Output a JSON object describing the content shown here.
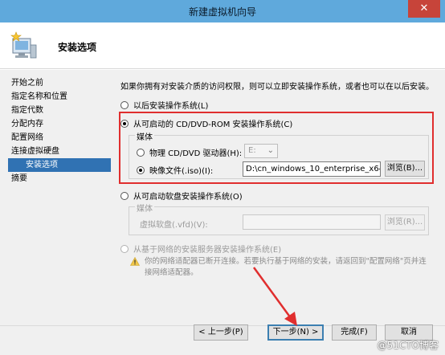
{
  "window": {
    "title": "新建虚拟机向导",
    "close_glyph": "✕"
  },
  "header": {
    "page_title": "安装选项"
  },
  "nav": {
    "items": [
      {
        "label": "开始之前"
      },
      {
        "label": "指定名称和位置"
      },
      {
        "label": "指定代数"
      },
      {
        "label": "分配内存"
      },
      {
        "label": "配置网络"
      },
      {
        "label": "连接虚拟硬盘"
      },
      {
        "label": "安装选项"
      },
      {
        "label": "摘要"
      }
    ],
    "active_index": 6
  },
  "content": {
    "intro": "如果你拥有对安装介质的访问权限，则可以立即安装操作系统，或者也可以在以后安装。",
    "option_later": "以后安装操作系统(L)",
    "option_dvd": "从可启动的 CD/DVD-ROM 安装操作系统(C)",
    "dvd_group_label": "媒体",
    "physical_drive_label": "物理 CD/DVD 驱动器(H):",
    "physical_drive_value": "E:",
    "iso_label": "映像文件(.iso)(I):",
    "iso_value": "D:\\cn_windows_10_enterprise_x64",
    "browse_label": "浏览(B)...",
    "option_floppy": "从可启动软盘安装操作系统(O)",
    "floppy_group_label": "媒体",
    "vfd_label": "虚拟软盘(.vfd)(V):",
    "vfd_value": "",
    "vfd_browse_label": "浏览(R)...",
    "option_network": "从基于网络的安装服务器安装操作系统(E)",
    "network_warning": "你的网络适配器已断开连接。若要执行基于网络的安装，请返回到\"配置网络\"页并连接网络适配器。",
    "selected_option": "dvd",
    "selected_media": "iso"
  },
  "footer": {
    "prev_label": "< 上一步(P)",
    "next_label": "下一步(N) >",
    "finish_label": "完成(F)",
    "cancel_label": "取消"
  },
  "watermark": "@51CTO博客",
  "colors": {
    "titlebar": "#5fa9dc",
    "close": "#c7443a",
    "nav_active": "#3072b3",
    "highlight": "#e02e2e",
    "annotation_arrow": "#e02e2e"
  }
}
